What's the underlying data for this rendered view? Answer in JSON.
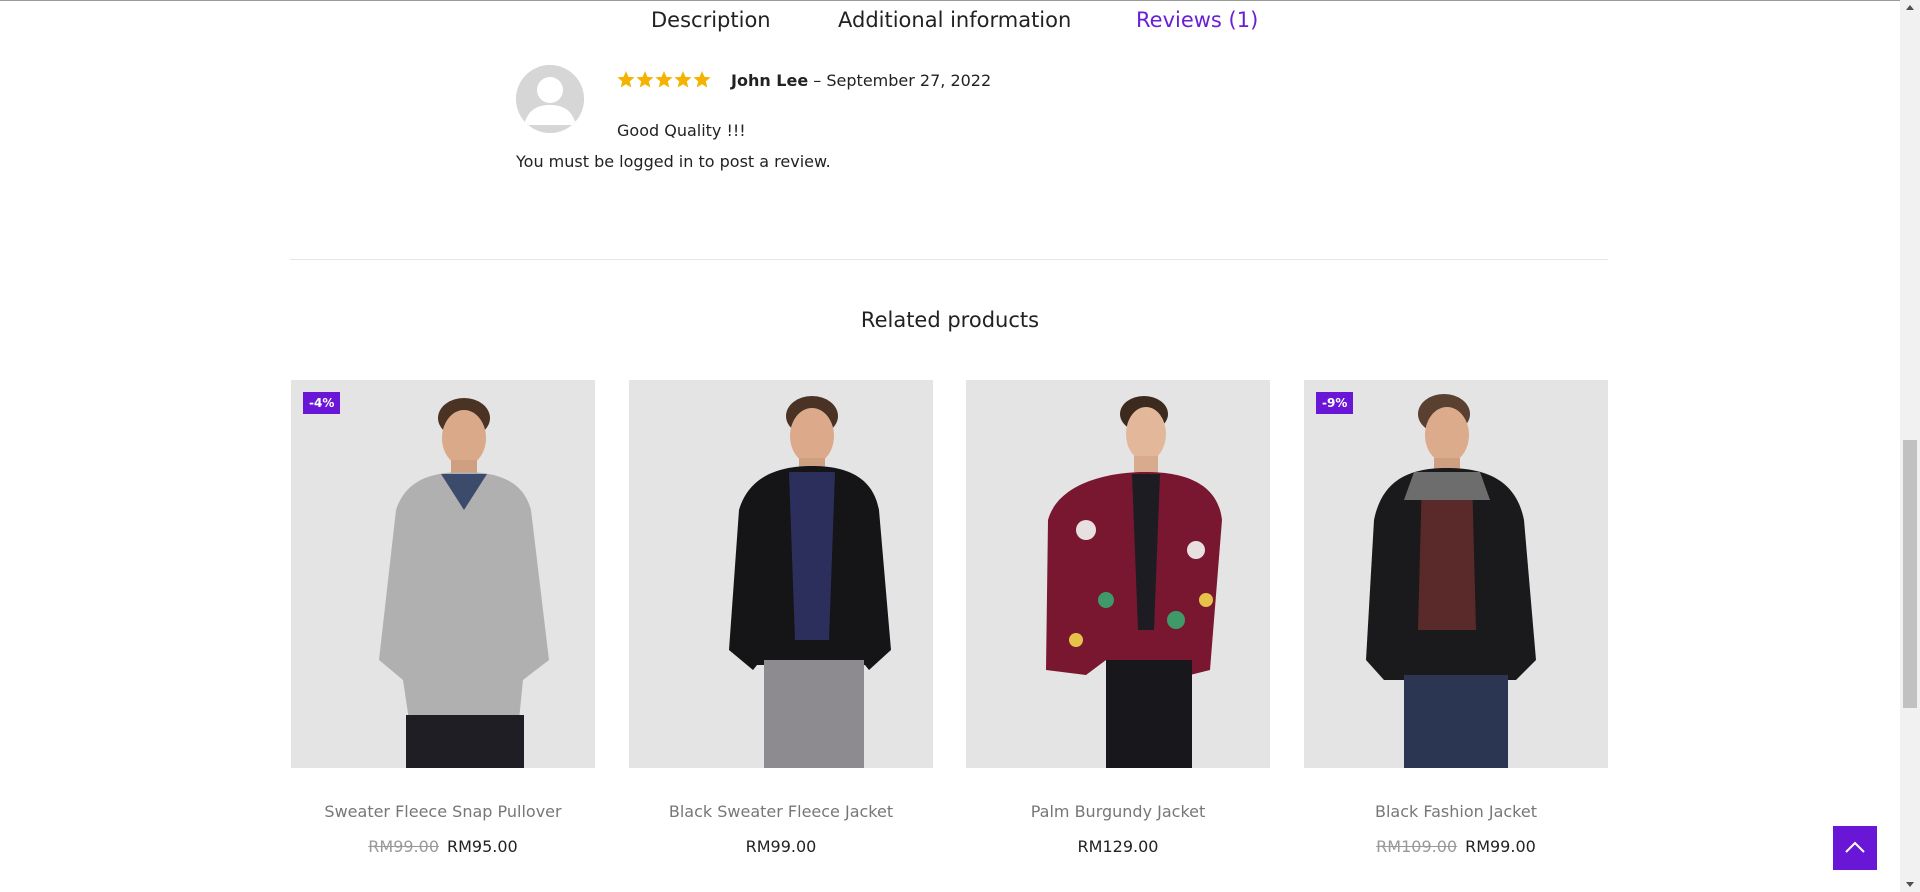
{
  "tabs": {
    "description": "Description",
    "additional": "Additional information",
    "reviews": "Reviews (1)"
  },
  "review": {
    "rating": 5,
    "author": "John Lee",
    "separator": "–",
    "date": "September 27, 2022",
    "text": "Good Quality !!!"
  },
  "login_note": "You must be logged in to post a review.",
  "related": {
    "title": "Related products",
    "products": [
      {
        "name": "Sweater Fleece Snap Pullover",
        "badge": "-4%",
        "old_price": "RM99.00",
        "price": "RM95.00"
      },
      {
        "name": "Black Sweater Fleece Jacket",
        "badge": "",
        "old_price": "",
        "price": "RM99.00"
      },
      {
        "name": "Palm Burgundy Jacket",
        "badge": "",
        "old_price": "",
        "price": "RM129.00"
      },
      {
        "name": "Black Fashion Jacket",
        "badge": "-9%",
        "old_price": "RM109.00",
        "price": "RM99.00"
      }
    ]
  },
  "colors": {
    "accent": "#6a16d6",
    "star": "#f5b301"
  },
  "icons": {
    "back_to_top": "chevron-up-icon"
  }
}
